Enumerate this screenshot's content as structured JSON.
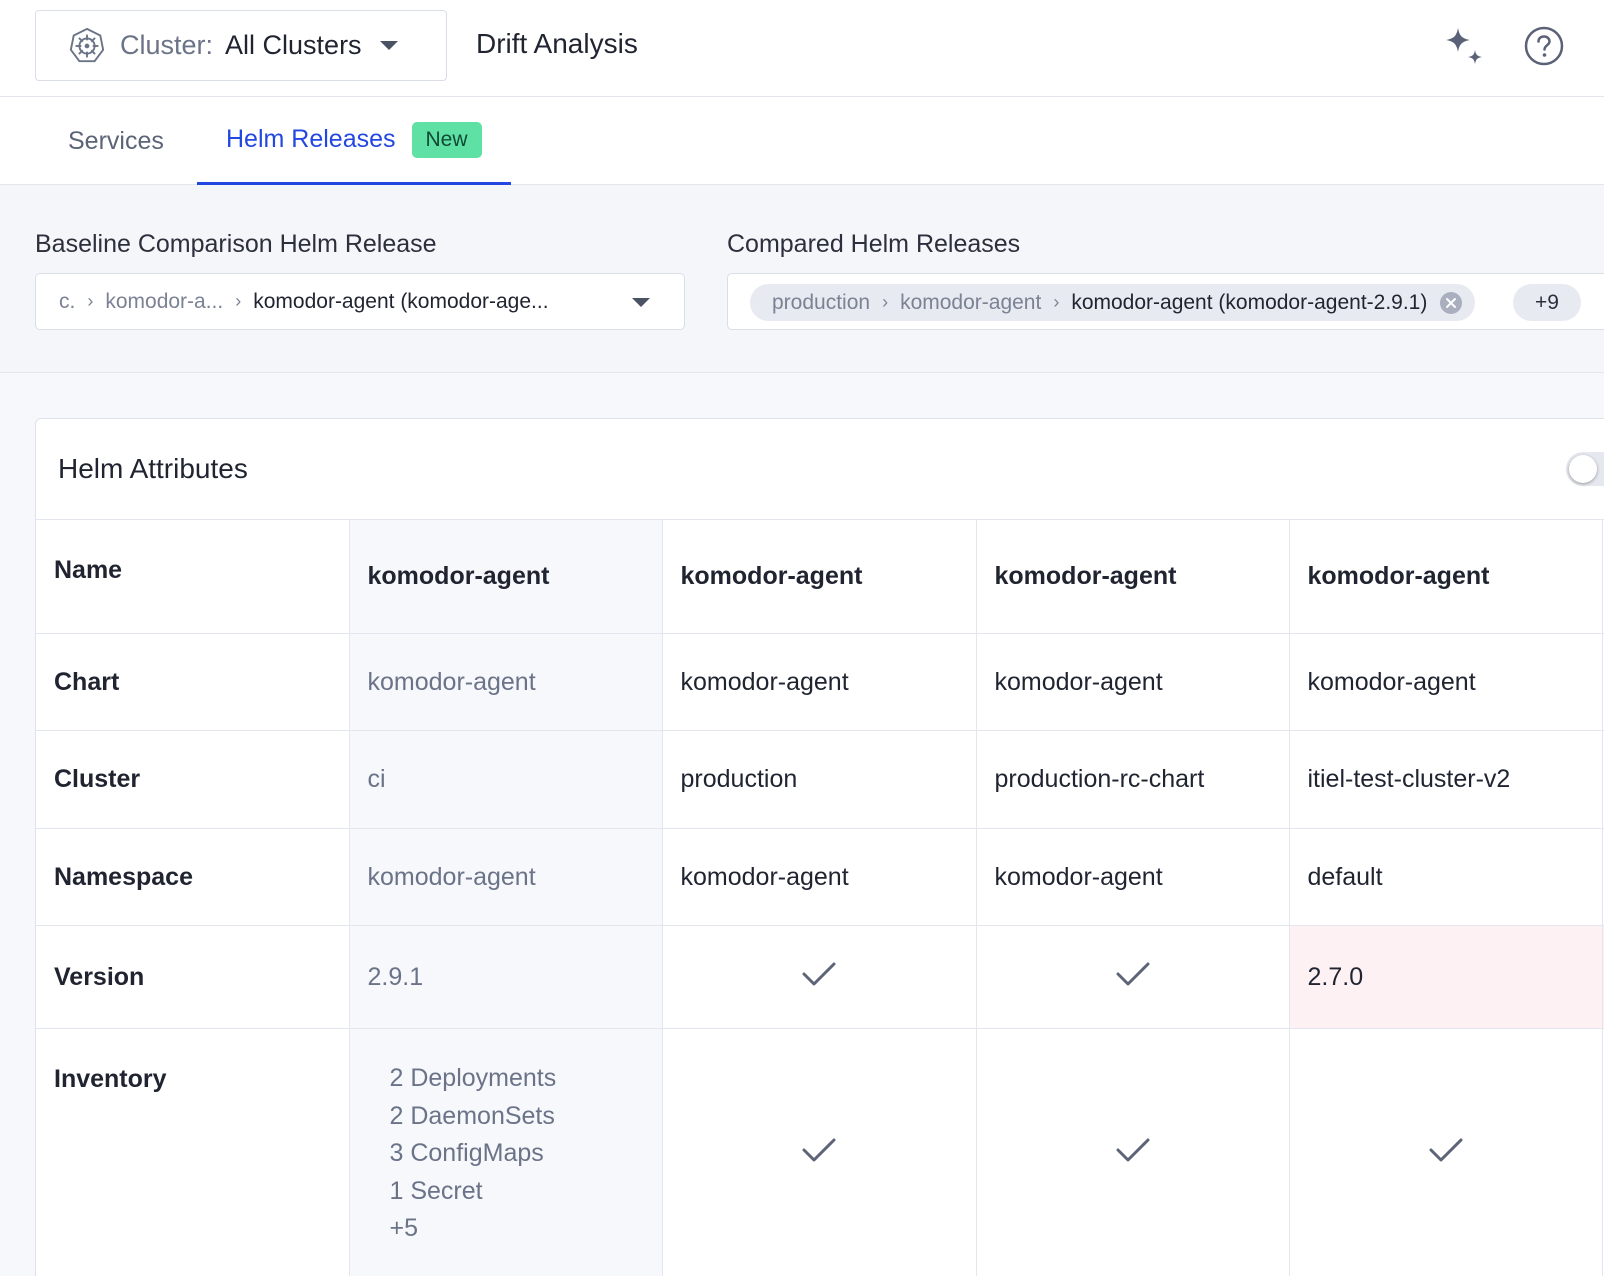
{
  "header": {
    "cluster_label": "Cluster:",
    "cluster_value": "All Clusters",
    "page_title": "Drift Analysis"
  },
  "tabs": [
    {
      "label": "Services",
      "active": false
    },
    {
      "label": "Helm Releases",
      "active": true,
      "badge": "New"
    }
  ],
  "filters": {
    "baseline_label": "Baseline Comparison Helm Release",
    "baseline_crumbs": [
      "c.",
      "komodor-a...",
      "komodor-agent (komodor-age..."
    ],
    "compared_label": "Compared Helm Releases",
    "compared_chip": [
      "production",
      "komodor-agent",
      "komodor-agent (komodor-agent-2.9.1)"
    ],
    "compared_more": "+9"
  },
  "card": {
    "title": "Helm Attributes",
    "toggle_on": false
  },
  "table": {
    "rows": {
      "name": "Name",
      "chart": "Chart",
      "cluster": "Cluster",
      "namespace": "Namespace",
      "version": "Version",
      "inventory": "Inventory"
    },
    "columns": [
      {
        "name": "komodor-agent",
        "chart": "komodor-agent",
        "cluster": "ci",
        "namespace": "komodor-agent",
        "version": "2.9.1",
        "inventory": [
          "2 Deployments",
          "2 DaemonSets",
          "3 ConfigMaps",
          "1 Secret",
          "+5"
        ]
      },
      {
        "name": "komodor-agent",
        "chart": "komodor-agent",
        "cluster": "production",
        "namespace": "komodor-agent",
        "version_match": true,
        "inventory_match": true
      },
      {
        "name": "komodor-agent",
        "chart": "komodor-agent",
        "cluster": "production-rc-chart",
        "namespace": "komodor-agent",
        "version_match": true,
        "inventory_match": true
      },
      {
        "name": "komodor-agent",
        "chart": "komodor-agent",
        "cluster": "itiel-test-cluster-v2",
        "namespace": "default",
        "version": "2.7.0",
        "inventory_match": true
      }
    ]
  },
  "colors": {
    "accent": "#2347e0",
    "badge_new": "#5fe0a5",
    "diff_cell": "#fdf1f4"
  }
}
